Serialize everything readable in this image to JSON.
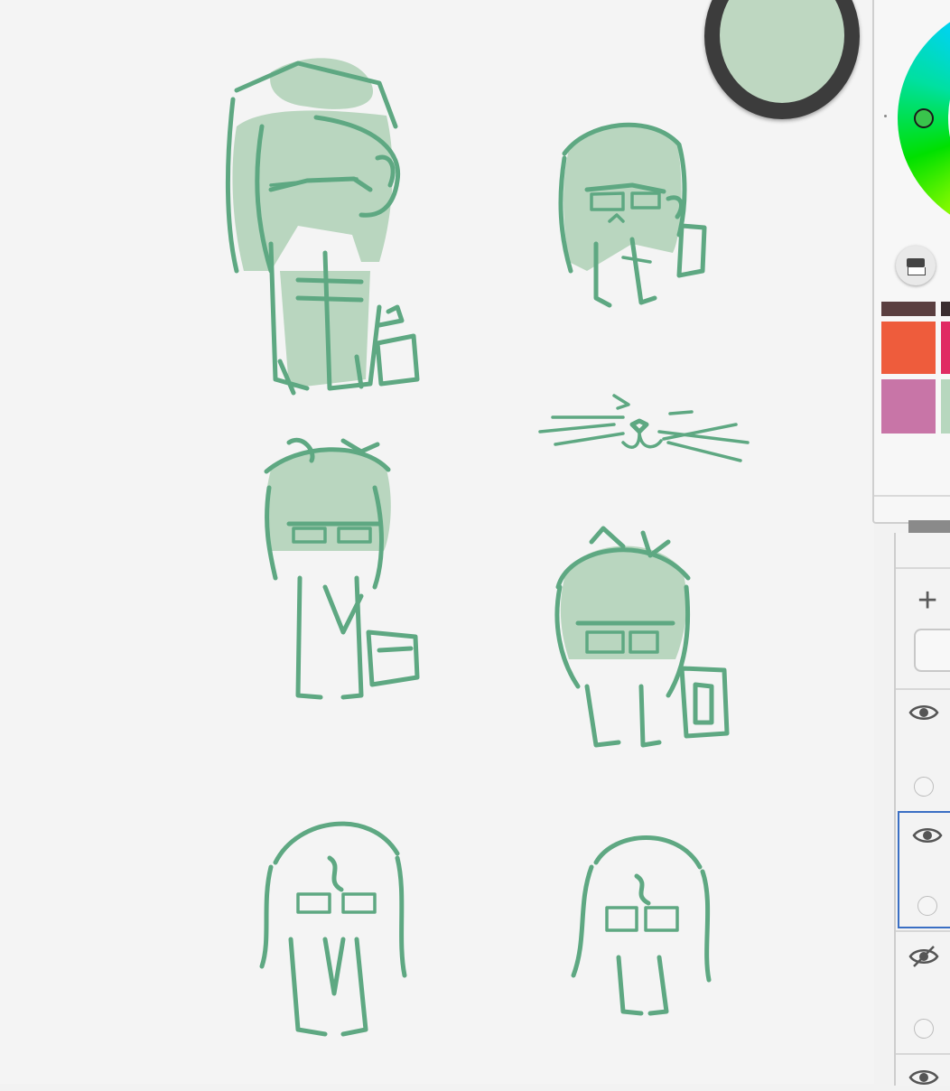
{
  "app": {
    "canvas": {
      "description_name": "sketch-canvas"
    },
    "color_puck": {
      "color": "#bed7c1"
    },
    "brush_color": "#5ea882",
    "color_panel": {
      "wheel_cursor_color": "#39c44c",
      "copy_icon": "copy-color-icon",
      "swatches": [
        {
          "color": "#5a3f40"
        },
        {
          "color": "#3a2e30"
        },
        {
          "color": "#ee5c3c"
        },
        {
          "color": "#e02a63"
        },
        {
          "color": "#c875a7"
        },
        {
          "color": "#b7d7be"
        }
      ]
    },
    "layers_panel": {
      "add_label": "+",
      "layers": [
        {
          "visible": true,
          "selected": false
        },
        {
          "visible": true,
          "selected": true
        },
        {
          "visible": false,
          "selected": false
        },
        {
          "visible": true,
          "selected": false
        }
      ]
    }
  }
}
